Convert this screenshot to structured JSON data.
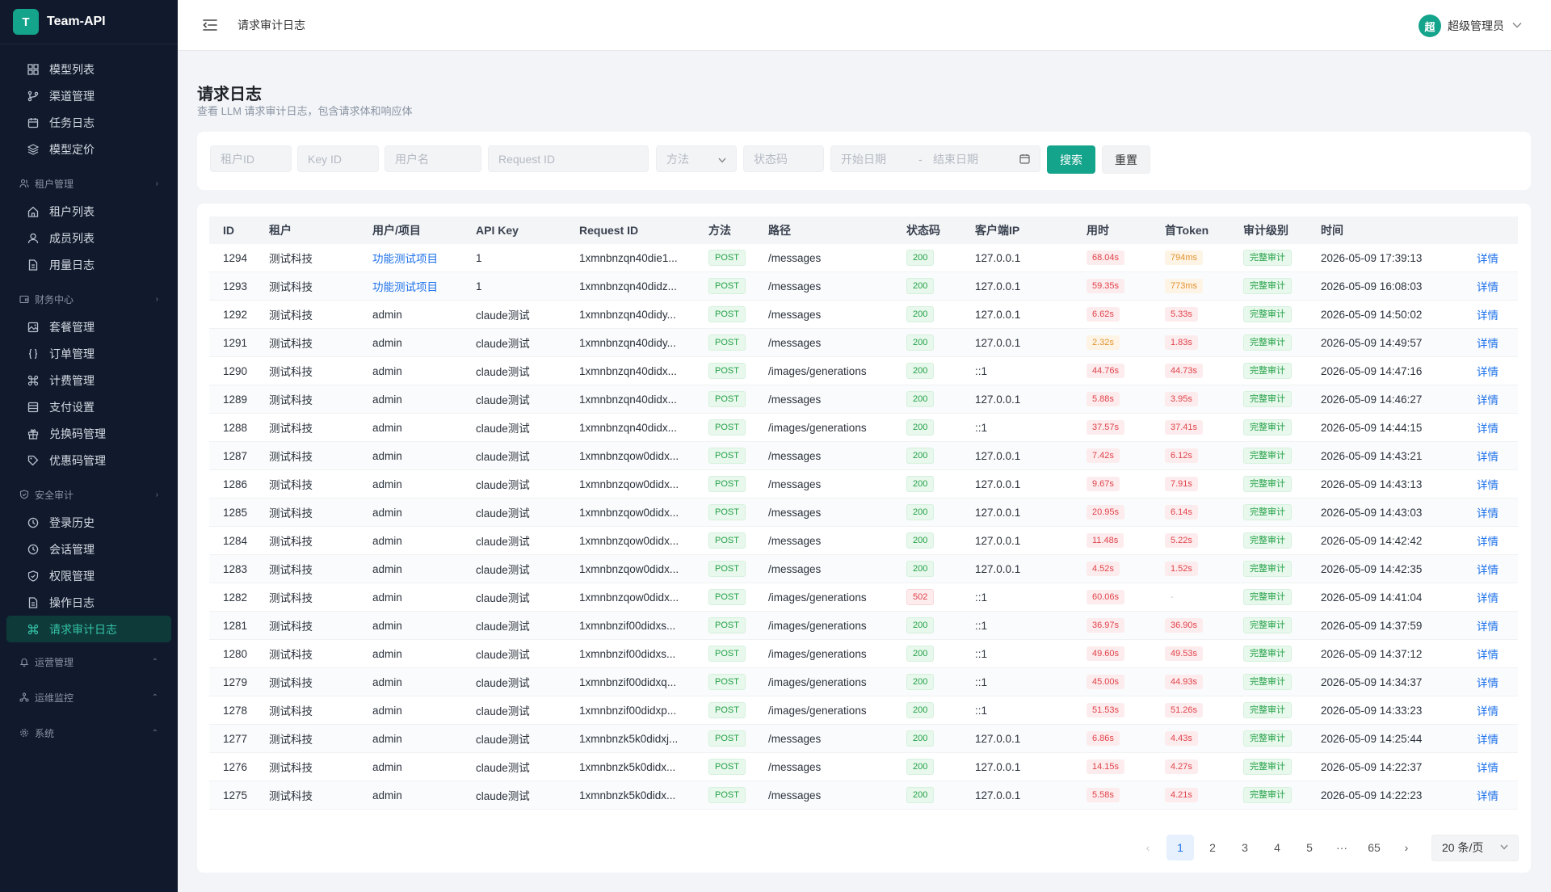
{
  "brand": {
    "logo_letter": "T",
    "name": "Team-API"
  },
  "sidebar": {
    "top_items": [
      {
        "label": "模型列表",
        "icon": "grid-icon"
      },
      {
        "label": "渠道管理",
        "icon": "branch-icon"
      },
      {
        "label": "任务日志",
        "icon": "calendar-icon"
      },
      {
        "label": "模型定价",
        "icon": "layers-icon"
      }
    ],
    "groups": [
      {
        "label": "租户管理",
        "items": [
          {
            "label": "租户列表",
            "icon": "home-icon"
          },
          {
            "label": "成员列表",
            "icon": "user-icon"
          },
          {
            "label": "用量日志",
            "icon": "file-icon"
          }
        ]
      },
      {
        "label": "财务中心",
        "items": [
          {
            "label": "套餐管理",
            "icon": "image-icon"
          },
          {
            "label": "订单管理",
            "icon": "braces-icon"
          },
          {
            "label": "计费管理",
            "icon": "command-icon"
          },
          {
            "label": "支付设置",
            "icon": "list-icon"
          },
          {
            "label": "兑换码管理",
            "icon": "gift-icon"
          },
          {
            "label": "优惠码管理",
            "icon": "tag-icon"
          }
        ]
      },
      {
        "label": "安全审计",
        "items": [
          {
            "label": "登录历史",
            "icon": "clock-icon"
          },
          {
            "label": "会话管理",
            "icon": "clock-icon"
          },
          {
            "label": "权限管理",
            "icon": "shield-icon"
          },
          {
            "label": "操作日志",
            "icon": "file-icon"
          },
          {
            "label": "请求审计日志",
            "icon": "command-icon",
            "active": true
          }
        ]
      }
    ],
    "collapsed_groups": [
      "运营管理",
      "运维监控",
      "系统"
    ]
  },
  "header": {
    "breadcrumb": "请求审计日志",
    "user_avatar": "超",
    "user_name": "超级管理员"
  },
  "page": {
    "title": "请求日志",
    "subtitle": "查看 LLM 请求审计日志，包含请求体和响应体"
  },
  "filters": {
    "tenant_id": "租户ID",
    "key_id": "Key ID",
    "username": "用户名",
    "request_id": "Request ID",
    "method": "方法",
    "status_code": "状态码",
    "start_date": "开始日期",
    "date_sep": "-",
    "end_date": "结束日期",
    "search": "搜索",
    "reset": "重置"
  },
  "table": {
    "headers": [
      "ID",
      "租户",
      "用户/项目",
      "API Key",
      "Request ID",
      "方法",
      "路径",
      "状态码",
      "客户端IP",
      "用时",
      "首Token",
      "审计级别",
      "时间"
    ],
    "action_label": "详情",
    "rows": [
      {
        "id": "1294",
        "tenant": "测试科技",
        "user": "功能测试项目",
        "user_link": true,
        "key": "1",
        "req": "1xmnbnzqn40die1...",
        "method": "POST",
        "path": "/messages",
        "status": "200",
        "ip": "127.0.0.1",
        "time": "68.04s",
        "time_c": "red",
        "first": "794ms",
        "first_c": "orange",
        "level": "完整审计",
        "date": "2026-05-09 17:39:13"
      },
      {
        "id": "1293",
        "tenant": "测试科技",
        "user": "功能测试项目",
        "user_link": true,
        "key": "1",
        "req": "1xmnbnzqn40didz...",
        "method": "POST",
        "path": "/messages",
        "status": "200",
        "ip": "127.0.0.1",
        "time": "59.35s",
        "time_c": "red",
        "first": "773ms",
        "first_c": "orange",
        "level": "完整审计",
        "date": "2026-05-09 16:08:03"
      },
      {
        "id": "1292",
        "tenant": "测试科技",
        "user": "admin",
        "user_link": false,
        "key": "claude测试",
        "req": "1xmnbnzqn40didy...",
        "method": "POST",
        "path": "/messages",
        "status": "200",
        "ip": "127.0.0.1",
        "time": "6.62s",
        "time_c": "red",
        "first": "5.33s",
        "first_c": "red",
        "level": "完整审计",
        "date": "2026-05-09 14:50:02"
      },
      {
        "id": "1291",
        "tenant": "测试科技",
        "user": "admin",
        "user_link": false,
        "key": "claude测试",
        "req": "1xmnbnzqn40didy...",
        "method": "POST",
        "path": "/messages",
        "status": "200",
        "ip": "127.0.0.1",
        "time": "2.32s",
        "time_c": "orange",
        "first": "1.83s",
        "first_c": "red",
        "level": "完整审计",
        "date": "2026-05-09 14:49:57"
      },
      {
        "id": "1290",
        "tenant": "测试科技",
        "user": "admin",
        "user_link": false,
        "key": "claude测试",
        "req": "1xmnbnzqn40didx...",
        "method": "POST",
        "path": "/images/generations",
        "status": "200",
        "ip": "::1",
        "time": "44.76s",
        "time_c": "red",
        "first": "44.73s",
        "first_c": "red",
        "level": "完整审计",
        "date": "2026-05-09 14:47:16"
      },
      {
        "id": "1289",
        "tenant": "测试科技",
        "user": "admin",
        "user_link": false,
        "key": "claude测试",
        "req": "1xmnbnzqn40didx...",
        "method": "POST",
        "path": "/messages",
        "status": "200",
        "ip": "127.0.0.1",
        "time": "5.88s",
        "time_c": "red",
        "first": "3.95s",
        "first_c": "red",
        "level": "完整审计",
        "date": "2026-05-09 14:46:27"
      },
      {
        "id": "1288",
        "tenant": "测试科技",
        "user": "admin",
        "user_link": false,
        "key": "claude测试",
        "req": "1xmnbnzqn40didx...",
        "method": "POST",
        "path": "/images/generations",
        "status": "200",
        "ip": "::1",
        "time": "37.57s",
        "time_c": "red",
        "first": "37.41s",
        "first_c": "red",
        "level": "完整审计",
        "date": "2026-05-09 14:44:15"
      },
      {
        "id": "1287",
        "tenant": "测试科技",
        "user": "admin",
        "user_link": false,
        "key": "claude测试",
        "req": "1xmnbnzqow0didx...",
        "method": "POST",
        "path": "/messages",
        "status": "200",
        "ip": "127.0.0.1",
        "time": "7.42s",
        "time_c": "red",
        "first": "6.12s",
        "first_c": "red",
        "level": "完整审计",
        "date": "2026-05-09 14:43:21"
      },
      {
        "id": "1286",
        "tenant": "测试科技",
        "user": "admin",
        "user_link": false,
        "key": "claude测试",
        "req": "1xmnbnzqow0didx...",
        "method": "POST",
        "path": "/messages",
        "status": "200",
        "ip": "127.0.0.1",
        "time": "9.67s",
        "time_c": "red",
        "first": "7.91s",
        "first_c": "red",
        "level": "完整审计",
        "date": "2026-05-09 14:43:13"
      },
      {
        "id": "1285",
        "tenant": "测试科技",
        "user": "admin",
        "user_link": false,
        "key": "claude测试",
        "req": "1xmnbnzqow0didx...",
        "method": "POST",
        "path": "/messages",
        "status": "200",
        "ip": "127.0.0.1",
        "time": "20.95s",
        "time_c": "red",
        "first": "6.14s",
        "first_c": "red",
        "level": "完整审计",
        "date": "2026-05-09 14:43:03"
      },
      {
        "id": "1284",
        "tenant": "测试科技",
        "user": "admin",
        "user_link": false,
        "key": "claude测试",
        "req": "1xmnbnzqow0didx...",
        "method": "POST",
        "path": "/messages",
        "status": "200",
        "ip": "127.0.0.1",
        "time": "11.48s",
        "time_c": "red",
        "first": "5.22s",
        "first_c": "red",
        "level": "完整审计",
        "date": "2026-05-09 14:42:42"
      },
      {
        "id": "1283",
        "tenant": "测试科技",
        "user": "admin",
        "user_link": false,
        "key": "claude测试",
        "req": "1xmnbnzqow0didx...",
        "method": "POST",
        "path": "/messages",
        "status": "200",
        "ip": "127.0.0.1",
        "time": "4.52s",
        "time_c": "red",
        "first": "1.52s",
        "first_c": "red",
        "level": "完整审计",
        "date": "2026-05-09 14:42:35"
      },
      {
        "id": "1282",
        "tenant": "测试科技",
        "user": "admin",
        "user_link": false,
        "key": "claude测试",
        "req": "1xmnbnzqow0didx...",
        "method": "POST",
        "path": "/images/generations",
        "status": "502",
        "ip": "::1",
        "time": "60.06s",
        "time_c": "red",
        "first": "-",
        "first_c": "gray",
        "level": "完整审计",
        "date": "2026-05-09 14:41:04"
      },
      {
        "id": "1281",
        "tenant": "测试科技",
        "user": "admin",
        "user_link": false,
        "key": "claude测试",
        "req": "1xmnbnzif00didxs...",
        "method": "POST",
        "path": "/images/generations",
        "status": "200",
        "ip": "::1",
        "time": "36.97s",
        "time_c": "red",
        "first": "36.90s",
        "first_c": "red",
        "level": "完整审计",
        "date": "2026-05-09 14:37:59"
      },
      {
        "id": "1280",
        "tenant": "测试科技",
        "user": "admin",
        "user_link": false,
        "key": "claude测试",
        "req": "1xmnbnzif00didxs...",
        "method": "POST",
        "path": "/images/generations",
        "status": "200",
        "ip": "::1",
        "time": "49.60s",
        "time_c": "red",
        "first": "49.53s",
        "first_c": "red",
        "level": "完整审计",
        "date": "2026-05-09 14:37:12"
      },
      {
        "id": "1279",
        "tenant": "测试科技",
        "user": "admin",
        "user_link": false,
        "key": "claude测试",
        "req": "1xmnbnzif00didxq...",
        "method": "POST",
        "path": "/images/generations",
        "status": "200",
        "ip": "::1",
        "time": "45.00s",
        "time_c": "red",
        "first": "44.93s",
        "first_c": "red",
        "level": "完整审计",
        "date": "2026-05-09 14:34:37"
      },
      {
        "id": "1278",
        "tenant": "测试科技",
        "user": "admin",
        "user_link": false,
        "key": "claude测试",
        "req": "1xmnbnzif00didxp...",
        "method": "POST",
        "path": "/images/generations",
        "status": "200",
        "ip": "::1",
        "time": "51.53s",
        "time_c": "red",
        "first": "51.26s",
        "first_c": "red",
        "level": "完整审计",
        "date": "2026-05-09 14:33:23"
      },
      {
        "id": "1277",
        "tenant": "测试科技",
        "user": "admin",
        "user_link": false,
        "key": "claude测试",
        "req": "1xmnbnzk5k0didxj...",
        "method": "POST",
        "path": "/messages",
        "status": "200",
        "ip": "127.0.0.1",
        "time": "6.86s",
        "time_c": "red",
        "first": "4.43s",
        "first_c": "red",
        "level": "完整审计",
        "date": "2026-05-09 14:25:44"
      },
      {
        "id": "1276",
        "tenant": "测试科技",
        "user": "admin",
        "user_link": false,
        "key": "claude测试",
        "req": "1xmnbnzk5k0didx...",
        "method": "POST",
        "path": "/messages",
        "status": "200",
        "ip": "127.0.0.1",
        "time": "14.15s",
        "time_c": "red",
        "first": "4.27s",
        "first_c": "red",
        "level": "完整审计",
        "date": "2026-05-09 14:22:37"
      },
      {
        "id": "1275",
        "tenant": "测试科技",
        "user": "admin",
        "user_link": false,
        "key": "claude测试",
        "req": "1xmnbnzk5k0didx...",
        "method": "POST",
        "path": "/messages",
        "status": "200",
        "ip": "127.0.0.1",
        "time": "5.58s",
        "time_c": "red",
        "first": "4.21s",
        "first_c": "red",
        "level": "完整审计",
        "date": "2026-05-09 14:22:23"
      }
    ]
  },
  "pagination": {
    "prev": "‹",
    "next": "›",
    "pages": [
      "1",
      "2",
      "3",
      "4",
      "5",
      "···",
      "65"
    ],
    "current": "1",
    "page_size": "20 条/页"
  },
  "colors": {
    "accent": "#14a38b",
    "sidebar_bg": "#111a2c",
    "link": "#1f72ea"
  }
}
